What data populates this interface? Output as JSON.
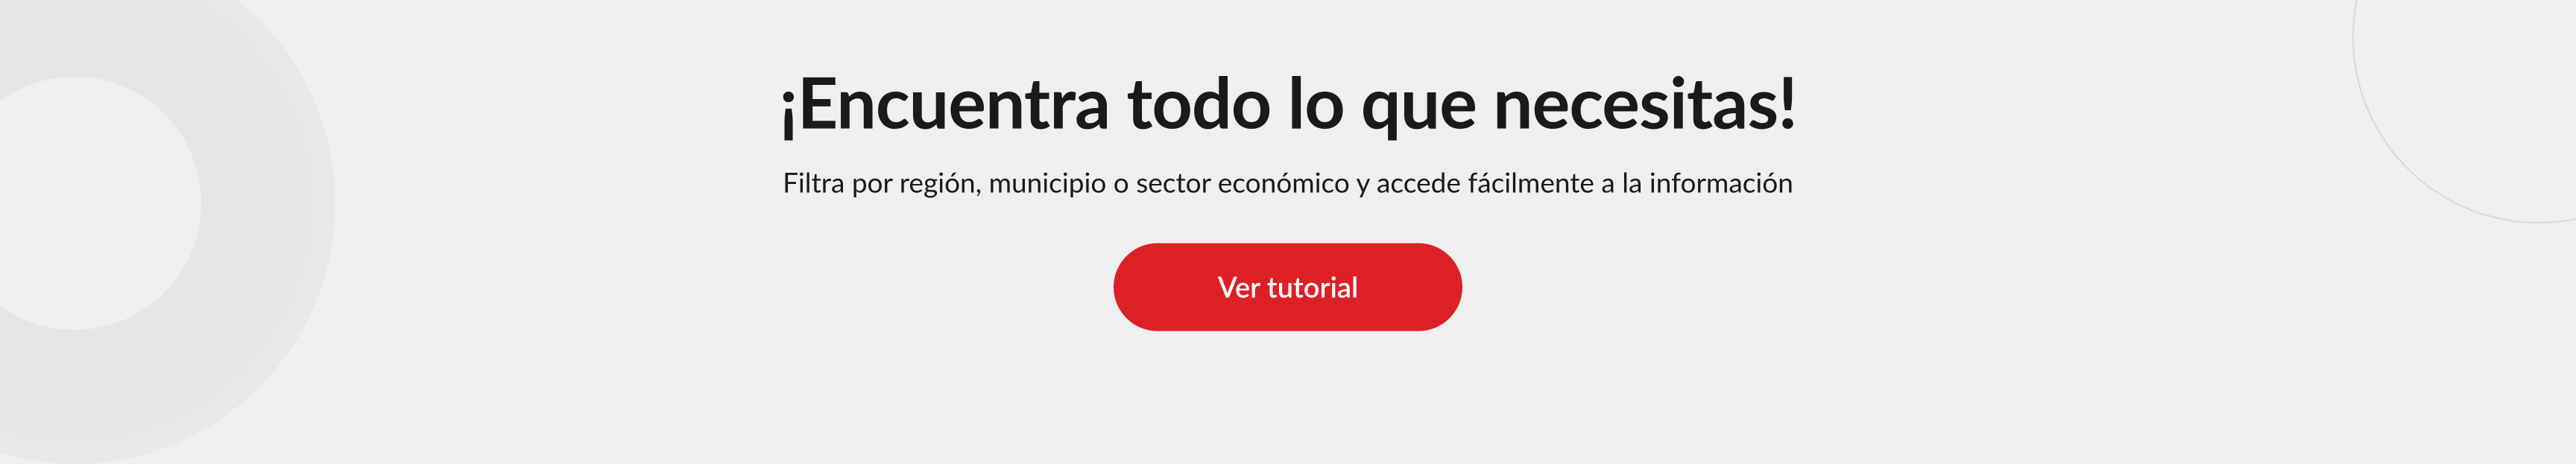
{
  "hero": {
    "heading": "¡Encuentra todo lo que necesitas!",
    "subtitle": "Filtra por región, municipio o sector económico y accede fácilmente a la información",
    "cta_label": "Ver tutorial"
  }
}
